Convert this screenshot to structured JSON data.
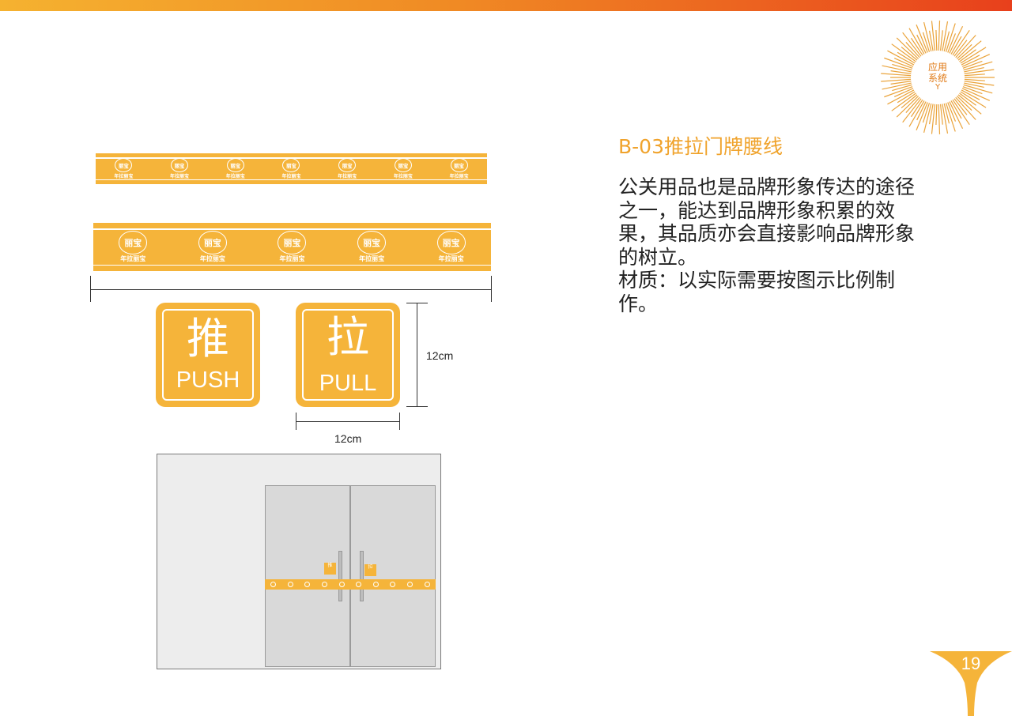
{
  "header": {
    "accent_colors": [
      "#f5b230",
      "#f08a24",
      "#e8401c"
    ]
  },
  "badge": {
    "line1": "应用",
    "line2": "系统",
    "mark": "Y",
    "icon": "sunburst-icon"
  },
  "section": {
    "title": "B-03推拉门牌腰线",
    "paragraphs": [
      "公关用品也是品牌形象传达的途径之一，能达到品牌形象积累的效果，其品质亦会直接影响品牌形象的树立。",
      "材质：以实际需要按图示比例制作。"
    ]
  },
  "waistline": {
    "brand_name": "年拉丽宝",
    "emblem": "丽宝",
    "color": "#f5b43a"
  },
  "signs": {
    "push": {
      "zh": "推",
      "en": "PUSH"
    },
    "pull": {
      "zh": "拉",
      "en": "PULL"
    },
    "height_label": "12cm",
    "width_label": "12cm"
  },
  "door_scene": {
    "mini_push": "推\nPUSH",
    "mini_pull": "拉\nPULL"
  },
  "footer": {
    "page_number": "19"
  }
}
